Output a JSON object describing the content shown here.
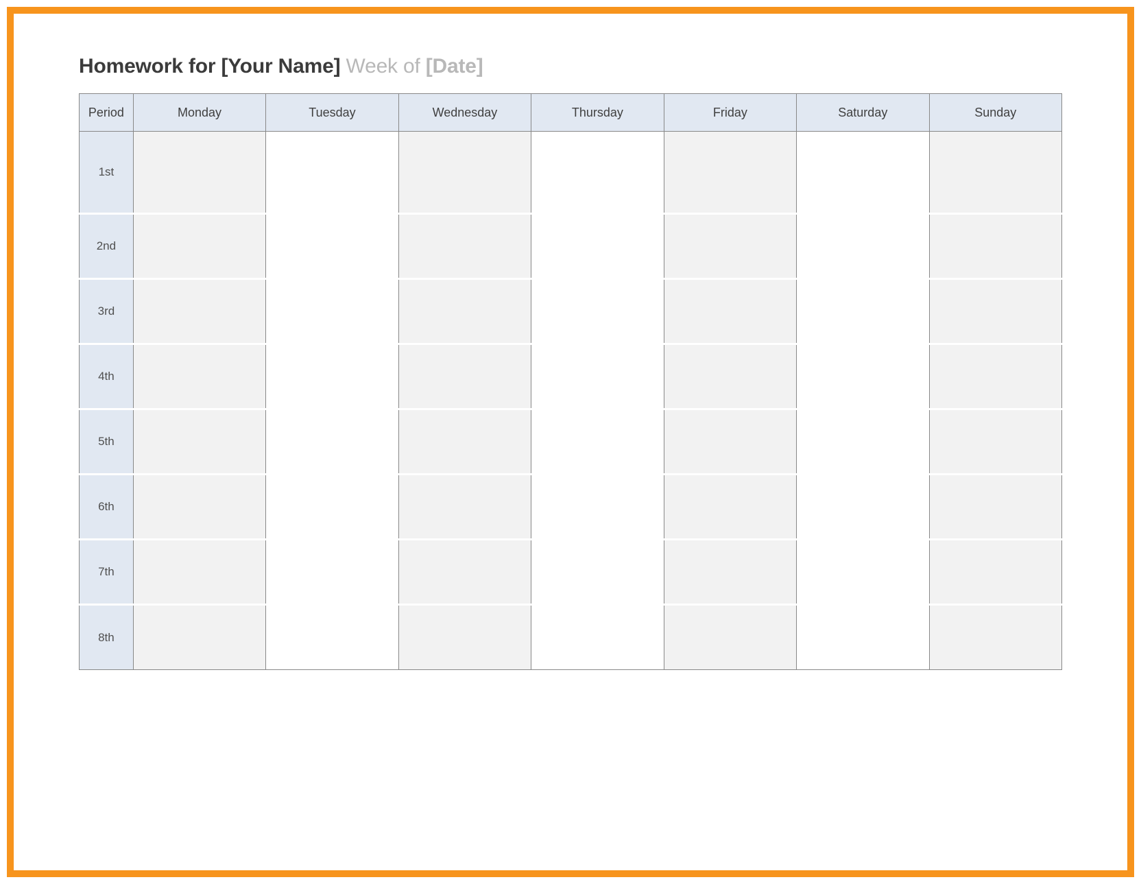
{
  "title": {
    "prefix": "Homework for ",
    "name_placeholder": "[Your Name]",
    "weekof": "Week of ",
    "date_placeholder": "[Date]"
  },
  "columns": [
    "Period",
    "Monday",
    "Tuesday",
    "Wednesday",
    "Thursday",
    "Friday",
    "Saturday",
    "Sunday"
  ],
  "periods": [
    "1st",
    "2nd",
    "3rd",
    "4th",
    "5th",
    "6th",
    "7th",
    "8th"
  ],
  "cells": [
    [
      "",
      "",
      "",
      "",
      "",
      "",
      ""
    ],
    [
      "",
      "",
      "",
      "",
      "",
      "",
      ""
    ],
    [
      "",
      "",
      "",
      "",
      "",
      "",
      ""
    ],
    [
      "",
      "",
      "",
      "",
      "",
      "",
      ""
    ],
    [
      "",
      "",
      "",
      "",
      "",
      "",
      ""
    ],
    [
      "",
      "",
      "",
      "",
      "",
      "",
      ""
    ],
    [
      "",
      "",
      "",
      "",
      "",
      "",
      ""
    ],
    [
      "",
      "",
      "",
      "",
      "",
      "",
      ""
    ]
  ]
}
